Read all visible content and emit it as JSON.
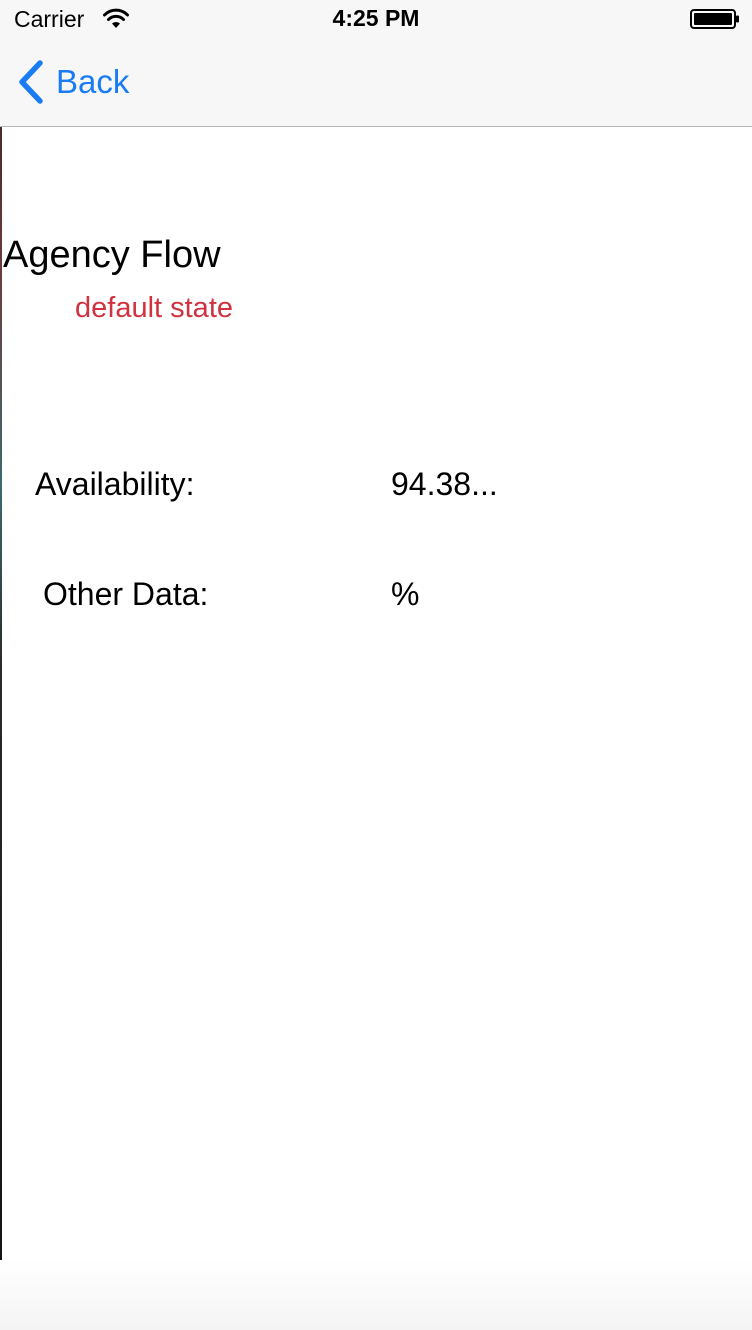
{
  "status_bar": {
    "carrier": "Carrier",
    "time": "4:25 PM",
    "wifi_icon": "wifi-icon",
    "battery_icon": "battery-icon"
  },
  "nav_bar": {
    "back_label": "Back",
    "back_icon": "chevron-left-icon",
    "accent_color": "#1a7cf4"
  },
  "content": {
    "title": "Agency Flow",
    "subtitle": "default state",
    "subtitle_color": "#d0323f",
    "rows": [
      {
        "label": "Availability:",
        "value": "94.38..."
      },
      {
        "label": "Other Data:",
        "value": "%"
      }
    ]
  }
}
